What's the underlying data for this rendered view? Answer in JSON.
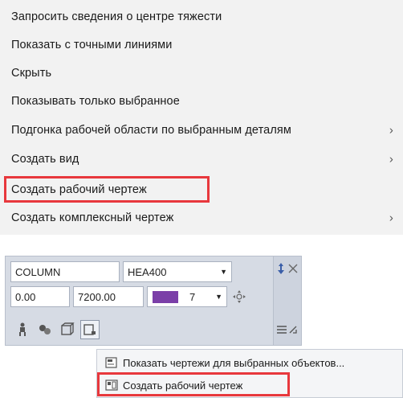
{
  "context_menu": {
    "items": [
      {
        "label": "Запросить сведения о центре тяжести",
        "submenu": false
      },
      {
        "label": "Показать с точными линиями",
        "submenu": false
      },
      {
        "label": "Скрыть",
        "submenu": false
      },
      {
        "label": "Показывать только выбранное",
        "submenu": false
      },
      {
        "label": "Подгонка рабочей области по выбранным деталям",
        "submenu": true
      },
      {
        "label": "Создать вид",
        "submenu": true
      },
      {
        "label": "Создать рабочий чертеж",
        "submenu": false,
        "highlighted": true
      },
      {
        "label": "Создать комплексный чертеж",
        "submenu": true
      }
    ],
    "chevron": "›"
  },
  "toolbar": {
    "name_value": "COLUMN",
    "profile_value": "HEA400",
    "x_value": "0.00",
    "length_value": "7200.00",
    "color_value": "7",
    "color_swatch": "#7b3fa8",
    "icons": [
      "person-figure-icon",
      "parts-icon",
      "assembly-icon",
      "drawing-icon"
    ],
    "side_icons": [
      "pin-icon",
      "close-icon",
      "list-icon",
      "resize-icon"
    ]
  },
  "popup": {
    "items": [
      {
        "label": "Показать чертежи для выбранных объектов...",
        "icon": "drawings-list-icon"
      },
      {
        "label": "Создать рабочий чертеж",
        "icon": "create-drawing-icon",
        "highlighted": true
      }
    ]
  },
  "colors": {
    "highlight": "#e8383d",
    "menu_bg": "#f2f2f2",
    "panel_bg": "#d6dbe4"
  }
}
